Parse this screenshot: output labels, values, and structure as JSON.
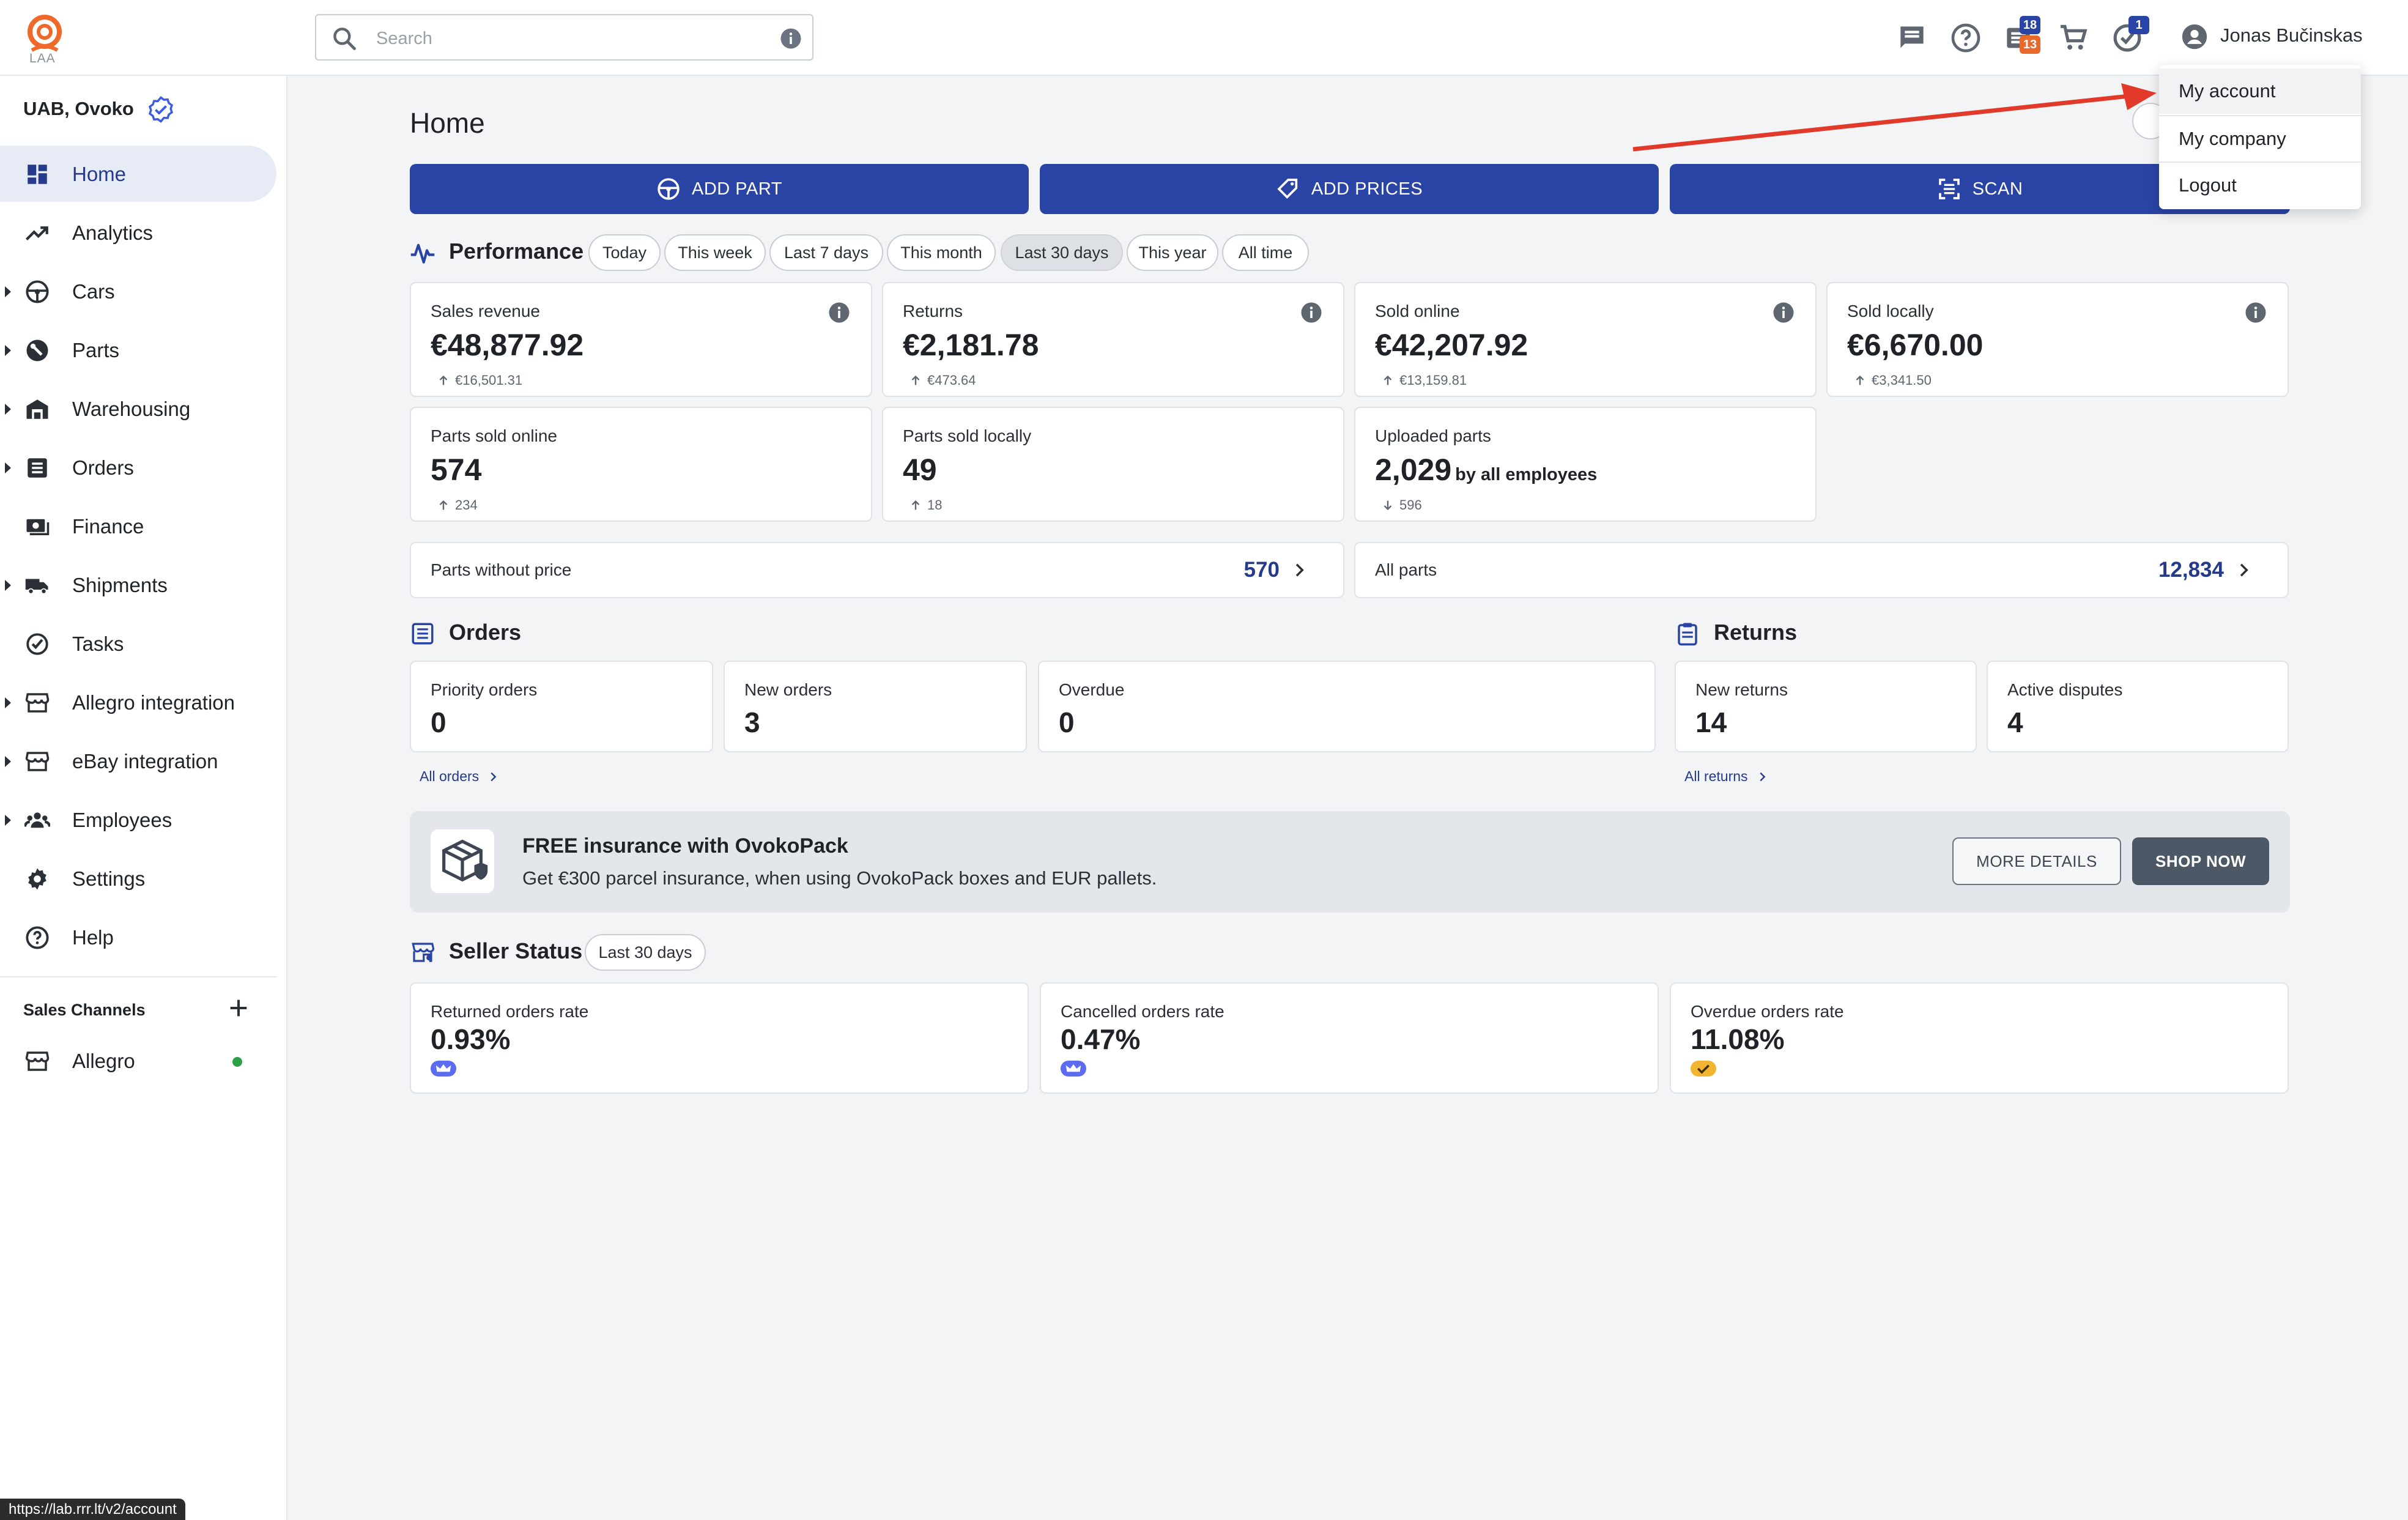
{
  "app": {
    "logo_text": "LAA",
    "company": "UAB, Ovoko"
  },
  "search": {
    "placeholder": "Search"
  },
  "topbar": {
    "messages_badge": "18",
    "messages_badge2": "13",
    "tasks_badge": "1",
    "user_name": "Jonas Bučinskas",
    "colors": {
      "blue_badge": "#2a44a6",
      "orange_badge": "#e8692a"
    }
  },
  "sidebar": {
    "items": [
      {
        "label": "Home",
        "icon": "dashboard-icon",
        "expandable": false,
        "active": true
      },
      {
        "label": "Analytics",
        "icon": "trending-up-icon",
        "expandable": false
      },
      {
        "label": "Cars",
        "icon": "car-icon",
        "expandable": true
      },
      {
        "label": "Parts",
        "icon": "part-icon",
        "expandable": true
      },
      {
        "label": "Warehousing",
        "icon": "warehouse-icon",
        "expandable": true
      },
      {
        "label": "Orders",
        "icon": "list-icon",
        "expandable": true
      },
      {
        "label": "Finance",
        "icon": "money-icon",
        "expandable": false
      },
      {
        "label": "Shipments",
        "icon": "truck-icon",
        "expandable": true
      },
      {
        "label": "Tasks",
        "icon": "check-circle-icon",
        "expandable": false
      },
      {
        "label": "Allegro integration",
        "icon": "store-icon",
        "expandable": true
      },
      {
        "label": "eBay integration",
        "icon": "store-icon",
        "expandable": true
      },
      {
        "label": "Employees",
        "icon": "people-icon",
        "expandable": true
      },
      {
        "label": "Settings",
        "icon": "gear-icon",
        "expandable": false
      },
      {
        "label": "Help",
        "icon": "help-icon",
        "expandable": false
      }
    ],
    "sales_channels_title": "Sales Channels",
    "channels": [
      {
        "label": "Allegro",
        "status_color": "#2ea043"
      }
    ],
    "url_tooltip": "https://lab.rrr.lt/v2/account"
  },
  "main": {
    "title": "Home",
    "actions": [
      {
        "label": "ADD PART"
      },
      {
        "label": "ADD PRICES"
      },
      {
        "label": "SCAN"
      }
    ],
    "performance": {
      "title": "Performance",
      "ranges": [
        "Today",
        "This week",
        "Last 7 days",
        "This month",
        "Last 30 days",
        "This year",
        "All time"
      ],
      "selected": "Last 30 days",
      "cards": [
        {
          "label": "Sales revenue",
          "value": "€48,877.92",
          "delta": "€16,501.31",
          "trend": "up"
        },
        {
          "label": "Returns",
          "value": "€2,181.78",
          "delta": "€473.64",
          "trend": "up"
        },
        {
          "label": "Sold online",
          "value": "€42,207.92",
          "delta": "€13,159.81",
          "trend": "up"
        },
        {
          "label": "Sold locally",
          "value": "€6,670.00",
          "delta": "€3,341.50",
          "trend": "up"
        },
        {
          "label": "Parts sold online",
          "value": "574",
          "delta": "234",
          "trend": "up"
        },
        {
          "label": "Parts sold locally",
          "value": "49",
          "delta": "18",
          "trend": "up"
        },
        {
          "label": "Uploaded parts",
          "value": "2,029",
          "suffix": "by all employees",
          "delta": "596",
          "trend": "down"
        }
      ],
      "parts_without_price": {
        "label": "Parts without price",
        "value": "570"
      },
      "all_parts": {
        "label": "All parts",
        "value": "12,834"
      }
    },
    "orders": {
      "title": "Orders",
      "cards": [
        {
          "label": "Priority orders",
          "value": "0"
        },
        {
          "label": "New orders",
          "value": "3"
        },
        {
          "label": "Overdue",
          "value": "0"
        }
      ],
      "link": "All orders"
    },
    "returns": {
      "title": "Returns",
      "cards": [
        {
          "label": "New returns",
          "value": "14"
        },
        {
          "label": "Active disputes",
          "value": "4"
        }
      ],
      "link": "All returns"
    },
    "banner": {
      "title": "FREE insurance with OvokoPack",
      "text": "Get €300 parcel insurance, when using OvokoPack boxes and EUR pallets.",
      "more_details": "MORE DETAILS",
      "shop_now": "SHOP NOW"
    },
    "seller_status": {
      "title": "Seller Status",
      "range": "Last 30 days",
      "cards": [
        {
          "label": "Returned orders rate",
          "value": "0.93%",
          "indicator": "crown-icon",
          "color": "#5b6cf0"
        },
        {
          "label": "Cancelled orders rate",
          "value": "0.47%",
          "indicator": "crown-icon",
          "color": "#5b6cf0"
        },
        {
          "label": "Overdue orders rate",
          "value": "11.08%",
          "indicator": "check-icon",
          "color": "#f2b531"
        }
      ]
    }
  },
  "account_menu": {
    "items": [
      {
        "label": "My account",
        "hover": true
      },
      {
        "label": "My company"
      },
      {
        "label": "Logout"
      }
    ]
  },
  "annotation": {
    "arrow_color": "#e23a2a"
  }
}
